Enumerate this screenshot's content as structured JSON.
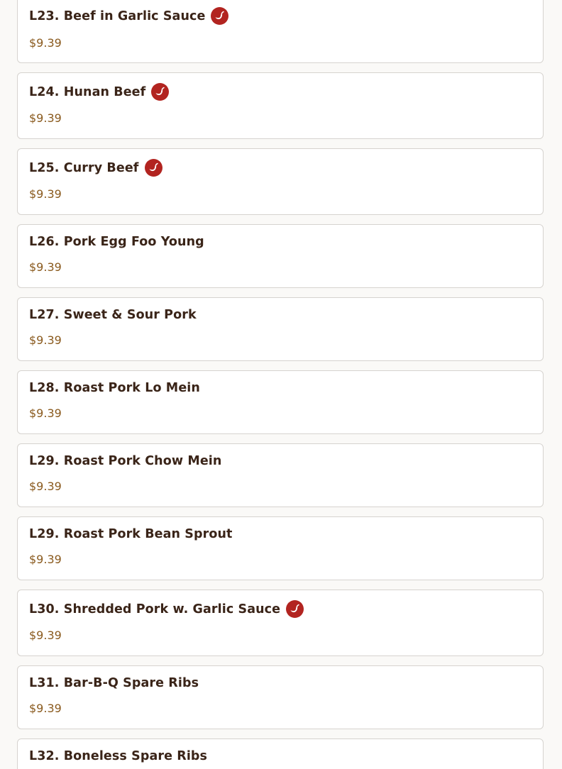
{
  "colors": {
    "name_text": "#3a2418",
    "price_text": "#8a5a1e",
    "spicy_icon": "#b22420",
    "card_border": "#d6d3cf",
    "page_background": "#faf9f7"
  },
  "icons": {
    "spicy": "chili-pepper-icon"
  },
  "menu_items": [
    {
      "name": "L23. Beef in Garlic Sauce",
      "price": "$9.39",
      "spicy": true
    },
    {
      "name": "L24. Hunan Beef",
      "price": "$9.39",
      "spicy": true
    },
    {
      "name": "L25. Curry Beef",
      "price": "$9.39",
      "spicy": true
    },
    {
      "name": "L26. Pork Egg Foo Young",
      "price": "$9.39",
      "spicy": false
    },
    {
      "name": "L27. Sweet & Sour Pork",
      "price": "$9.39",
      "spicy": false
    },
    {
      "name": "L28. Roast Pork Lo Mein",
      "price": "$9.39",
      "spicy": false
    },
    {
      "name": "L29. Roast Pork Chow Mein",
      "price": "$9.39",
      "spicy": false
    },
    {
      "name": "L29. Roast Pork Bean Sprout",
      "price": "$9.39",
      "spicy": false
    },
    {
      "name": "L30. Shredded Pork w. Garlic Sauce",
      "price": "$9.39",
      "spicy": true
    },
    {
      "name": "L31. Bar-B-Q Spare Ribs",
      "price": "$9.39",
      "spicy": false
    },
    {
      "name": "L32. Boneless Spare Ribs",
      "price": "",
      "spicy": false
    }
  ]
}
